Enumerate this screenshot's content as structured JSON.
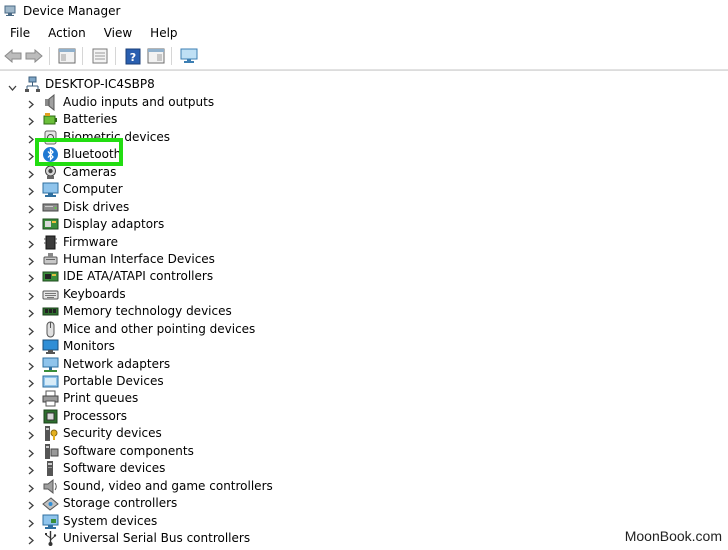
{
  "window": {
    "title": "Device Manager"
  },
  "menu": [
    "File",
    "Action",
    "View",
    "Help"
  ],
  "tree": {
    "root": "DESKTOP-IC4SBP8",
    "items": [
      {
        "label": "Audio inputs and outputs",
        "icon": "speaker-icon"
      },
      {
        "label": "Batteries",
        "icon": "battery-icon"
      },
      {
        "label": "Biometric devices",
        "icon": "biometric-icon"
      },
      {
        "label": "Bluetooth",
        "icon": "bluetooth-icon"
      },
      {
        "label": "Cameras",
        "icon": "camera-icon"
      },
      {
        "label": "Computer",
        "icon": "computer-icon"
      },
      {
        "label": "Disk drives",
        "icon": "disk-drive-icon"
      },
      {
        "label": "Display adaptors",
        "icon": "display-adapter-icon"
      },
      {
        "label": "Firmware",
        "icon": "firmware-icon"
      },
      {
        "label": "Human Interface Devices",
        "icon": "hid-icon"
      },
      {
        "label": "IDE ATA/ATAPI controllers",
        "icon": "ide-controller-icon"
      },
      {
        "label": "Keyboards",
        "icon": "keyboard-icon"
      },
      {
        "label": "Memory technology devices",
        "icon": "memory-icon"
      },
      {
        "label": "Mice and other pointing devices",
        "icon": "mouse-icon"
      },
      {
        "label": "Monitors",
        "icon": "monitor-icon"
      },
      {
        "label": "Network adapters",
        "icon": "network-adapter-icon"
      },
      {
        "label": "Portable Devices",
        "icon": "portable-device-icon"
      },
      {
        "label": "Print queues",
        "icon": "printer-icon"
      },
      {
        "label": "Processors",
        "icon": "processor-icon"
      },
      {
        "label": "Security devices",
        "icon": "security-device-icon"
      },
      {
        "label": "Software components",
        "icon": "software-component-icon"
      },
      {
        "label": "Software devices",
        "icon": "software-device-icon"
      },
      {
        "label": "Sound, video and game controllers",
        "icon": "sound-controller-icon"
      },
      {
        "label": "Storage controllers",
        "icon": "storage-controller-icon"
      },
      {
        "label": "System devices",
        "icon": "system-device-icon"
      },
      {
        "label": "Universal Serial Bus controllers",
        "icon": "usb-controller-icon"
      }
    ]
  },
  "highlight": {
    "target": "Bluetooth",
    "color": "#22dd11"
  },
  "watermark": "MoonBook.com"
}
